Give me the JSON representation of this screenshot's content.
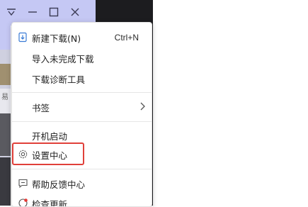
{
  "menu": {
    "items": [
      {
        "label": "新建下载(N)",
        "shortcut": "Ctrl+N",
        "icon": "new-download-icon"
      },
      {
        "label": "导入未完成下载"
      },
      {
        "label": "下载诊断工具"
      },
      {
        "label": "书签",
        "icon": "chevron-right-icon"
      },
      {
        "label": "开机启动"
      },
      {
        "label": "设置中心",
        "icon": "gear-icon"
      },
      {
        "label": "帮助反馈中心",
        "icon": "feedback-icon"
      },
      {
        "label": "检查更新",
        "icon": "update-icon"
      }
    ]
  },
  "window_controls": [
    "dropdown-icon",
    "minimize-icon",
    "maximize-icon",
    "close-icon"
  ],
  "background_partial": [
    "易"
  ],
  "colors": {
    "highlight": "#e0403a",
    "titlebar": "#c5c8f4",
    "dark_panel": "#1c1c1f"
  }
}
